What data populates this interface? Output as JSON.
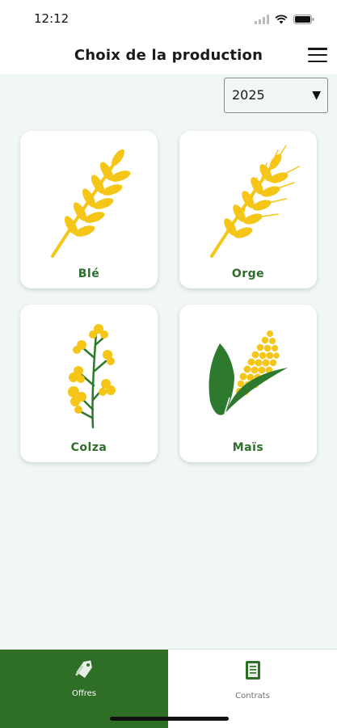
{
  "status_bar": {
    "time": "12:12"
  },
  "header": {
    "title": "Choix de la production"
  },
  "year_select": {
    "value": "2025"
  },
  "crops": [
    {
      "label": "Blé",
      "icon": "wheat-icon"
    },
    {
      "label": "Orge",
      "icon": "barley-icon"
    },
    {
      "label": "Colza",
      "icon": "rapeseed-icon"
    },
    {
      "label": "Maïs",
      "icon": "corn-icon"
    }
  ],
  "tabs": [
    {
      "label": "Offres",
      "icon": "tag-icon",
      "active": true
    },
    {
      "label": "Contrats",
      "icon": "document-icon",
      "active": false
    }
  ],
  "colors": {
    "accent": "#2e6e27",
    "label_green": "#2e6e2a",
    "grain_yellow": "#f5c518",
    "leaf_green": "#2d7a2e",
    "background": "#f1f8f4"
  }
}
